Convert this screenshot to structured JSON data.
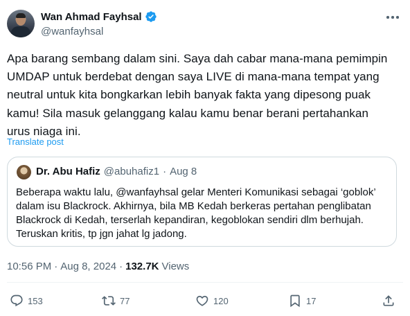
{
  "author": {
    "display_name": "Wan Ahmad Fayhsal",
    "handle": "@wanfayhsal",
    "verified_color": "#1d9bf0"
  },
  "tweet": {
    "text": "Apa barang sembang dalam sini. Saya dah cabar mana-mana pemimpin\nUMDAP untuk berdebat dengan saya LIVE di mana-mana tempat yang\nneutral untuk kita bongkarkan lebih banyak fakta yang dipesong puak\nkamu! Sila masuk gelanggang kalau kamu benar berani pertahankan\nurus niaga ini.",
    "translate_label": "Translate post"
  },
  "quote": {
    "display_name": "Dr. Abu Hafiz",
    "handle": "@abuhafiz1",
    "separator": "·",
    "date": "Aug 8",
    "text": "Beberapa waktu lalu, @wanfayhsal gelar Menteri Komunikasi sebagai ‘goblok’\ndalam isu Blackrock. Akhirnya, bila MB Kedah berkeras pertahan penglibatan\nBlackrock di Kedah, terserlah kepandiran, kegoblokan sendiri dlm berhujah.\nTeruskan kritis, tp jgn jahat lg jadong."
  },
  "meta": {
    "time": "10:56 PM",
    "sep1": "·",
    "date": "Aug 8, 2024",
    "sep2": "·",
    "views_count": "132.7K",
    "views_label": "Views"
  },
  "actions": {
    "replies": "153",
    "reposts": "77",
    "likes": "120",
    "bookmarks": "17",
    "icons": [
      "reply-icon",
      "repost-icon",
      "like-icon",
      "bookmark-icon",
      "share-icon"
    ],
    "icon_color": "#536471"
  }
}
